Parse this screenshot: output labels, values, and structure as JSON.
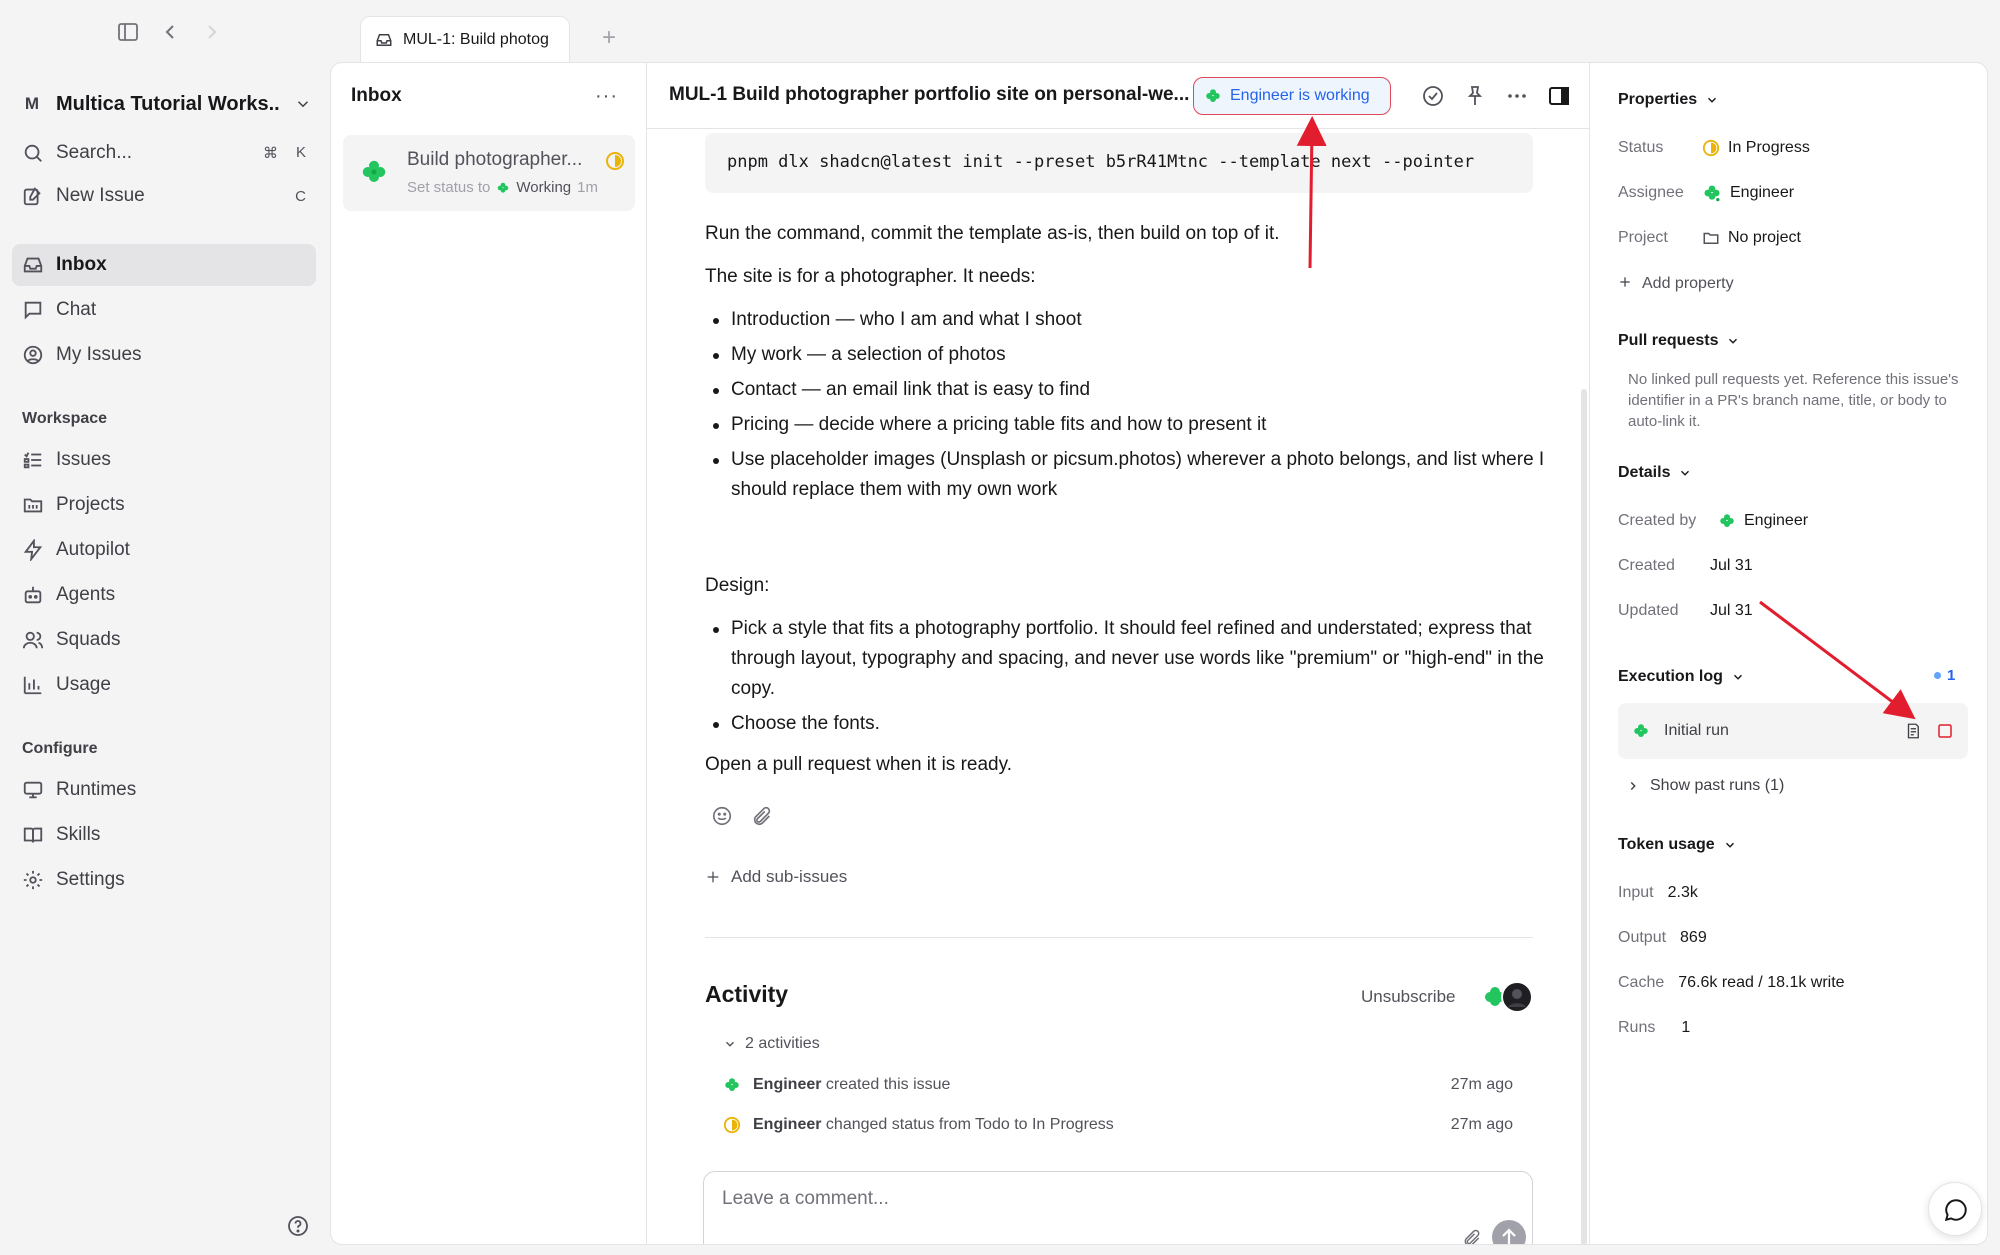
{
  "tab": {
    "title": "MUL-1: Build photog",
    "add": "+"
  },
  "sidebar": {
    "workspace_badge": "M",
    "workspace_name": "Multica Tutorial Works...",
    "search_label": "Search...",
    "search_kbd": [
      "⌘",
      "K"
    ],
    "new_issue_label": "New Issue",
    "new_issue_kbd": "C",
    "nav": [
      "Inbox",
      "Chat",
      "My Issues"
    ],
    "workspace_section": "Workspace",
    "workspace_items": [
      "Issues",
      "Projects",
      "Autopilot",
      "Agents",
      "Squads",
      "Usage"
    ],
    "configure_section": "Configure",
    "configure_items": [
      "Runtimes",
      "Skills",
      "Settings"
    ]
  },
  "inbox": {
    "title": "Inbox",
    "more": "···",
    "item_title": "Build photographer...",
    "item_sub_prefix": "Set status to",
    "item_sub_status": "Working",
    "item_time": "1m"
  },
  "issue": {
    "title": "MUL-1 Build photographer portfolio site on personal-we...",
    "working_label": "Engineer is working",
    "code": "pnpm dlx shadcn@latest init --preset b5rR41Mtnc --template next --pointer",
    "p1": "Run the command, commit the template as-is, then build on top of it.",
    "p2": "The site is for a photographer. It needs:",
    "needs": [
      "Introduction — who I am and what I shoot",
      "My work — a selection of photos",
      "Contact — an email link that is easy to find",
      "Pricing — decide where a pricing table fits and how to present it",
      "Use placeholder images (Unsplash or picsum.photos) wherever a photo belongs, and list where I should replace them with my own work"
    ],
    "design_label": "Design:",
    "design": [
      "Pick a style that fits a photography portfolio. It should feel refined and understated; express that through layout, typography and spacing, and never use words like \"premium\" or \"high-end\" in the copy.",
      "Choose the fonts."
    ],
    "closing": "Open a pull request when it is ready.",
    "add_sub_issues": "Add sub-issues"
  },
  "activity": {
    "title": "Activity",
    "unsubscribe": "Unsubscribe",
    "count": "2 activities",
    "rows": [
      {
        "actor": "Engineer",
        "text": "created this issue",
        "time": "27m ago"
      },
      {
        "actor": "Engineer",
        "text": "changed status from Todo to In Progress",
        "time": "27m ago"
      }
    ],
    "comment_placeholder": "Leave a comment..."
  },
  "properties": {
    "title": "Properties",
    "status_key": "Status",
    "status_value": "In Progress",
    "assignee_key": "Assignee",
    "assignee_value": "Engineer",
    "project_key": "Project",
    "project_value": "No project",
    "add_property": "Add property"
  },
  "pull_requests": {
    "title": "Pull requests",
    "empty": "No linked pull requests yet. Reference this issue's identifier in a PR's branch name, title, or body to auto-link it."
  },
  "details": {
    "title": "Details",
    "created_by_key": "Created by",
    "created_by_value": "Engineer",
    "created_key": "Created",
    "created_value": "Jul 31",
    "updated_key": "Updated",
    "updated_value": "Jul 31"
  },
  "execution_log": {
    "title": "Execution log",
    "count": "1",
    "run_label": "Initial run",
    "past_runs": "Show past runs (1)"
  },
  "token_usage": {
    "title": "Token usage",
    "input_key": "Input",
    "input_value": "2.3k",
    "output_key": "Output",
    "output_value": "869",
    "cache_key": "Cache",
    "cache_value": "76.6k read / 18.1k write",
    "runs_key": "Runs",
    "runs_value": "1"
  },
  "colors": {
    "accent": "#2563eb",
    "in_progress": "#eab308",
    "clover": "#22c55e",
    "annotation": "#e11d2e"
  }
}
